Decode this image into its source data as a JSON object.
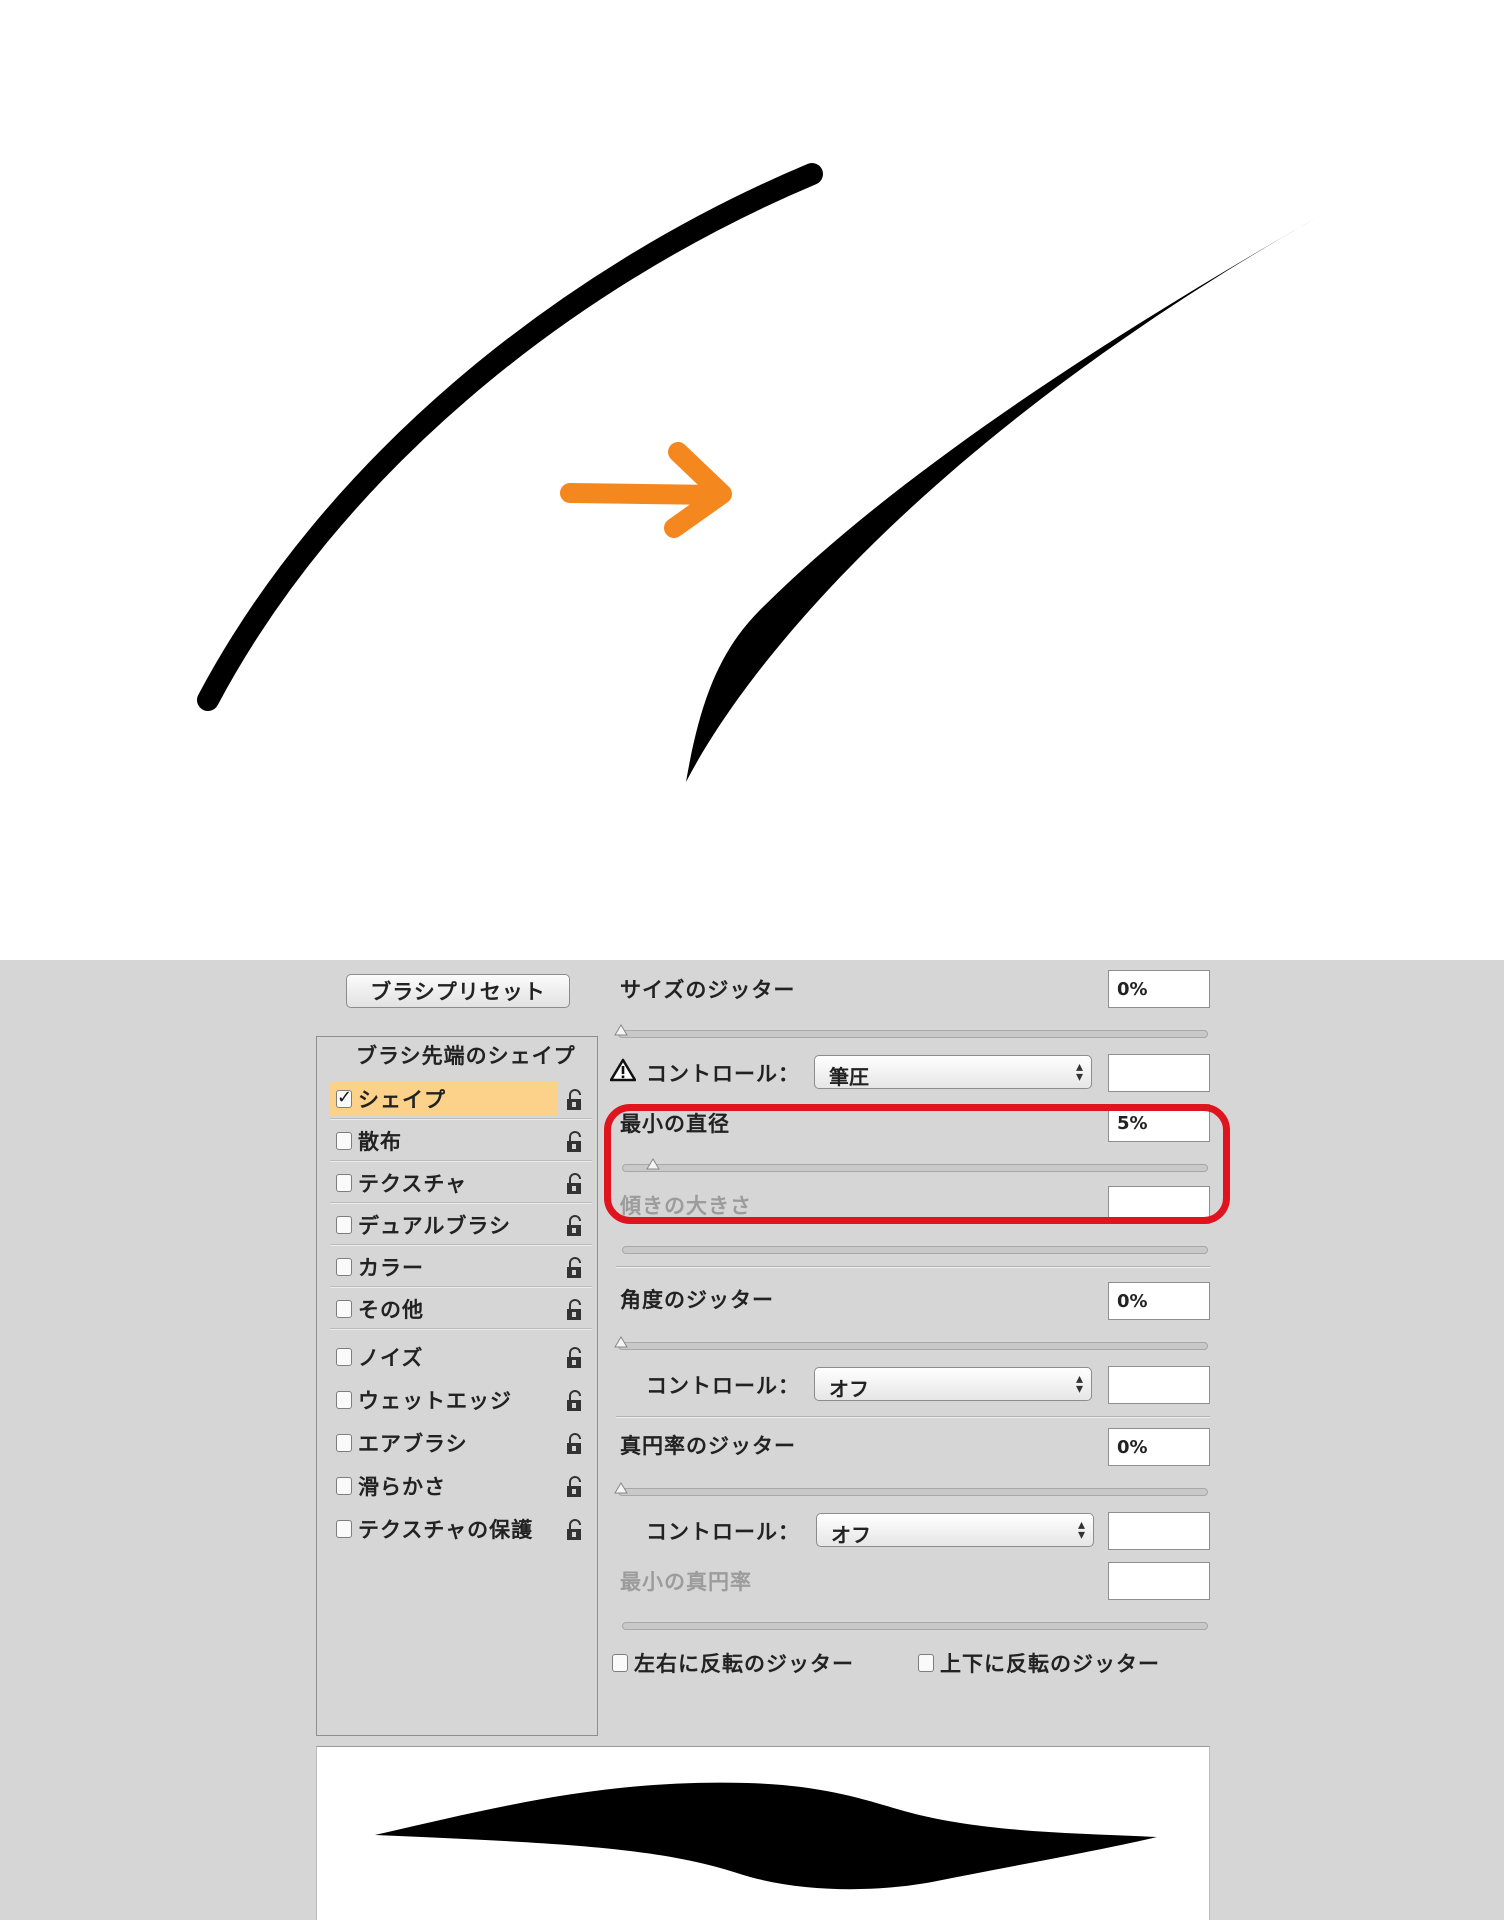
{
  "colors": {
    "arrow": "#f5871f",
    "highlight_box": "#e0141f",
    "selected_item": "#fcd28a",
    "panel_bg": "#d6d6d6"
  },
  "panel": {
    "preset_button": "ブラシプリセット",
    "list_header": "ブラシ先端のシェイプ",
    "items": [
      {
        "label": "シェイプ",
        "checked": true
      },
      {
        "label": "散布",
        "checked": false
      },
      {
        "label": "テクスチャ",
        "checked": false
      },
      {
        "label": "デュアルブラシ",
        "checked": false
      },
      {
        "label": "カラー",
        "checked": false
      },
      {
        "label": "その他",
        "checked": false
      },
      {
        "label": "ノイズ",
        "checked": false
      },
      {
        "label": "ウェットエッジ",
        "checked": false
      },
      {
        "label": "エアブラシ",
        "checked": false
      },
      {
        "label": "滑らかさ",
        "checked": false
      },
      {
        "label": "テクスチャの保護",
        "checked": false
      }
    ],
    "size_jitter": {
      "label": "サイズのジッター",
      "value": "0%"
    },
    "size_control": {
      "label": "コントロール：",
      "value": "筆圧",
      "icon": "warning-icon"
    },
    "min_diameter": {
      "label": "最小の直径",
      "value": "5%"
    },
    "tilt_scale": {
      "label": "傾きの大きさ",
      "value": ""
    },
    "angle_jitter": {
      "label": "角度のジッター",
      "value": "0%"
    },
    "angle_control": {
      "label": "コントロール：",
      "value": "オフ"
    },
    "roundness_jitter": {
      "label": "真円率のジッター",
      "value": "0%"
    },
    "roundness_control": {
      "label": "コントロール：",
      "value": "オフ"
    },
    "min_roundness": {
      "label": "最小の真円率",
      "value": ""
    },
    "flip_x": {
      "label": "左右に反転のジッター",
      "checked": false
    },
    "flip_y": {
      "label": "上下に反転のジッター",
      "checked": false
    }
  }
}
